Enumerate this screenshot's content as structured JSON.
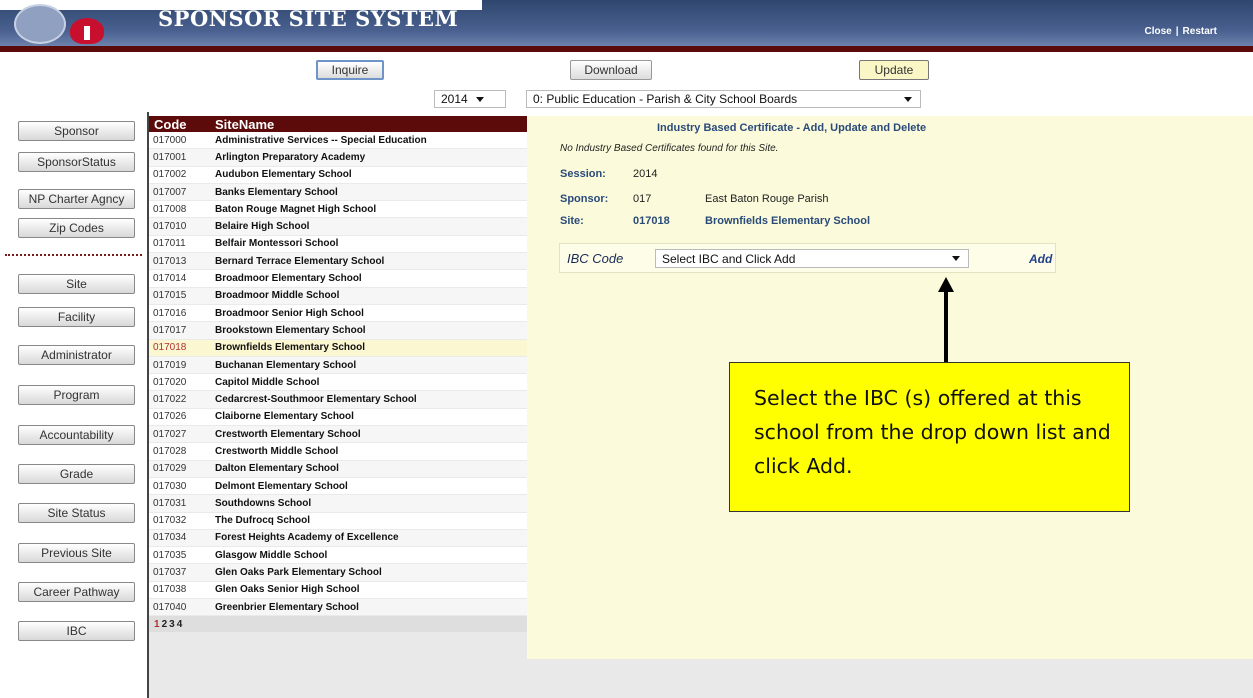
{
  "header": {
    "title": "SPONSOR SITE SYSTEM",
    "links": {
      "close": "Close",
      "separator": "|",
      "restart": "Restart"
    }
  },
  "toolbar": {
    "inquire": "Inquire",
    "download": "Download",
    "update": "Update",
    "year_value": "2014",
    "sponsor_value": "0: Public Education - Parish & City School Boards"
  },
  "nav": {
    "items": [
      "Sponsor",
      "SponsorStatus",
      "NP Charter Agncy",
      "Zip Codes",
      "Site",
      "Facility",
      "Administrator",
      "Program",
      "Accountability",
      "Grade",
      "Site Status",
      "Previous Site",
      "Career Pathway",
      "IBC"
    ]
  },
  "site_table": {
    "headers": {
      "code": "Code",
      "name": "SiteName"
    },
    "rows": [
      {
        "code": "017000",
        "name": "Administrative Services -- Special Education"
      },
      {
        "code": "017001",
        "name": "Arlington Preparatory Academy"
      },
      {
        "code": "017002",
        "name": "Audubon Elementary School"
      },
      {
        "code": "017007",
        "name": "Banks Elementary School"
      },
      {
        "code": "017008",
        "name": "Baton Rouge Magnet High School"
      },
      {
        "code": "017010",
        "name": "Belaire High School"
      },
      {
        "code": "017011",
        "name": "Belfair Montessori School"
      },
      {
        "code": "017013",
        "name": "Bernard Terrace Elementary School"
      },
      {
        "code": "017014",
        "name": "Broadmoor Elementary School"
      },
      {
        "code": "017015",
        "name": "Broadmoor Middle School"
      },
      {
        "code": "017016",
        "name": "Broadmoor Senior High School"
      },
      {
        "code": "017017",
        "name": "Brookstown Elementary School"
      },
      {
        "code": "017018",
        "name": "Brownfields Elementary School",
        "selected": true
      },
      {
        "code": "017019",
        "name": "Buchanan Elementary School"
      },
      {
        "code": "017020",
        "name": "Capitol Middle School"
      },
      {
        "code": "017022",
        "name": "Cedarcrest-Southmoor Elementary School"
      },
      {
        "code": "017026",
        "name": "Claiborne Elementary School"
      },
      {
        "code": "017027",
        "name": "Crestworth Elementary School"
      },
      {
        "code": "017028",
        "name": "Crestworth Middle School"
      },
      {
        "code": "017029",
        "name": "Dalton Elementary School"
      },
      {
        "code": "017030",
        "name": "Delmont Elementary School"
      },
      {
        "code": "017031",
        "name": "Southdowns School"
      },
      {
        "code": "017032",
        "name": "The Dufrocq School"
      },
      {
        "code": "017034",
        "name": "Forest Heights Academy of Excellence"
      },
      {
        "code": "017035",
        "name": "Glasgow Middle School"
      },
      {
        "code": "017037",
        "name": "Glen Oaks Park Elementary School"
      },
      {
        "code": "017038",
        "name": "Glen Oaks Senior High School"
      },
      {
        "code": "017040",
        "name": "Greenbrier Elementary School"
      }
    ],
    "pages": [
      "1",
      "2",
      "3",
      "4"
    ],
    "current_page": "1"
  },
  "detail": {
    "title": "Industry Based Certificate - Add, Update and Delete",
    "message": "No Industry Based Certificates found for this Site.",
    "session_label": "Session:",
    "session_value": "2014",
    "sponsor_label": "Sponsor:",
    "sponsor_code": "017",
    "sponsor_name": "East Baton Rouge Parish",
    "site_label": "Site:",
    "site_code": "017018",
    "site_name": "Brownfields Elementary School"
  },
  "ibc": {
    "label": "IBC Code",
    "select_value": "Select IBC and Click Add",
    "add_label": "Add"
  },
  "callout": {
    "text": "Select the IBC (s) offered at this school from the drop down list and click Add."
  }
}
